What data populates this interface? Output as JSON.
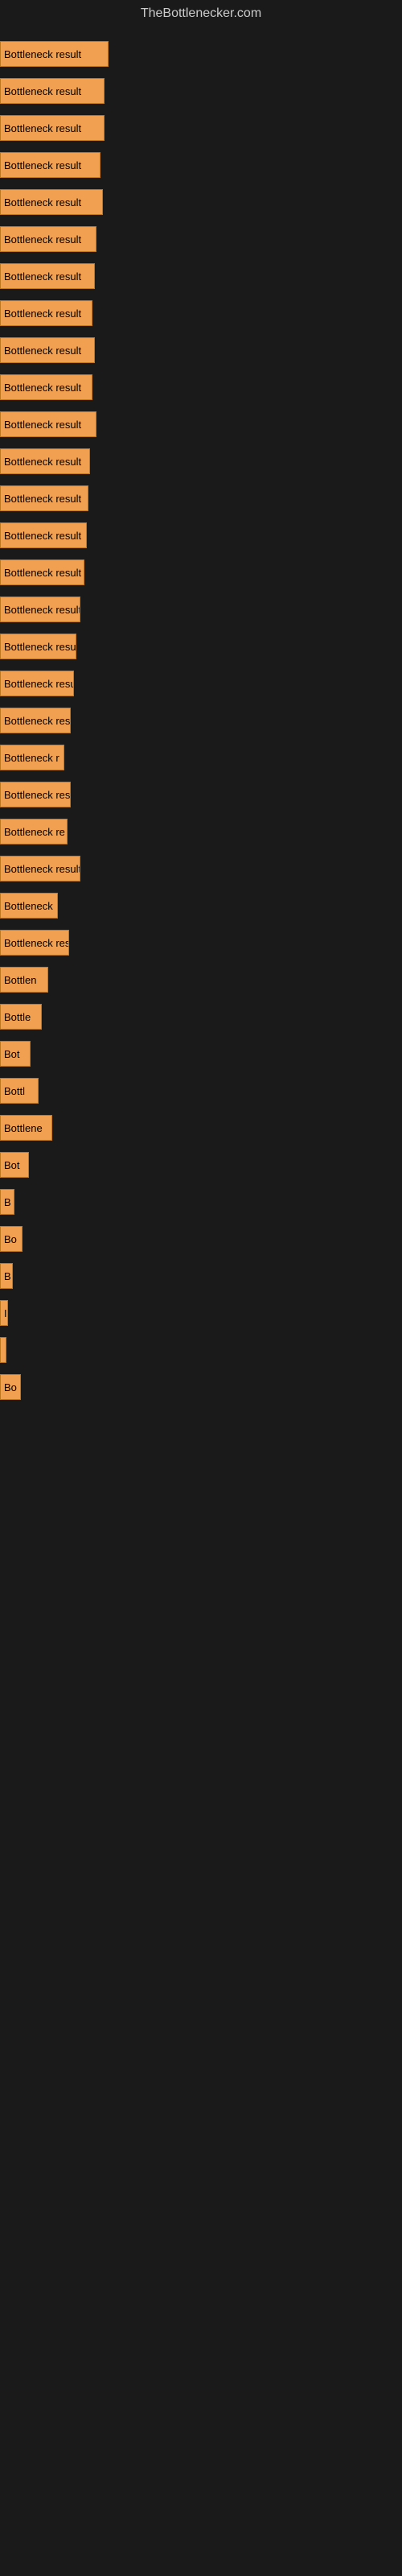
{
  "site": {
    "title": "TheBottlenecker.com"
  },
  "bars": [
    {
      "label": "Bottleneck result",
      "width": 135
    },
    {
      "label": "Bottleneck result",
      "width": 130
    },
    {
      "label": "Bottleneck result",
      "width": 130
    },
    {
      "label": "Bottleneck result",
      "width": 125
    },
    {
      "label": "Bottleneck result",
      "width": 128
    },
    {
      "label": "Bottleneck result",
      "width": 120
    },
    {
      "label": "Bottleneck result",
      "width": 118
    },
    {
      "label": "Bottleneck result",
      "width": 115
    },
    {
      "label": "Bottleneck result",
      "width": 118
    },
    {
      "label": "Bottleneck result",
      "width": 115
    },
    {
      "label": "Bottleneck result",
      "width": 120
    },
    {
      "label": "Bottleneck result",
      "width": 112
    },
    {
      "label": "Bottleneck result",
      "width": 110
    },
    {
      "label": "Bottleneck result",
      "width": 108
    },
    {
      "label": "Bottleneck result",
      "width": 105
    },
    {
      "label": "Bottleneck result",
      "width": 100
    },
    {
      "label": "Bottleneck result",
      "width": 95
    },
    {
      "label": "Bottleneck result",
      "width": 92
    },
    {
      "label": "Bottleneck resu",
      "width": 88
    },
    {
      "label": "Bottleneck r",
      "width": 80
    },
    {
      "label": "Bottleneck resu",
      "width": 88
    },
    {
      "label": "Bottleneck re",
      "width": 84
    },
    {
      "label": "Bottleneck result",
      "width": 100
    },
    {
      "label": "Bottleneck",
      "width": 72
    },
    {
      "label": "Bottleneck resu",
      "width": 86
    },
    {
      "label": "Bottlen",
      "width": 60
    },
    {
      "label": "Bottle",
      "width": 52
    },
    {
      "label": "Bot",
      "width": 38
    },
    {
      "label": "Bottl",
      "width": 48
    },
    {
      "label": "Bottlene",
      "width": 65
    },
    {
      "label": "Bot",
      "width": 36
    },
    {
      "label": "B",
      "width": 18
    },
    {
      "label": "Bo",
      "width": 28
    },
    {
      "label": "B",
      "width": 16
    },
    {
      "label": "I",
      "width": 10
    },
    {
      "label": "",
      "width": 8
    },
    {
      "label": "Bo",
      "width": 26
    }
  ]
}
